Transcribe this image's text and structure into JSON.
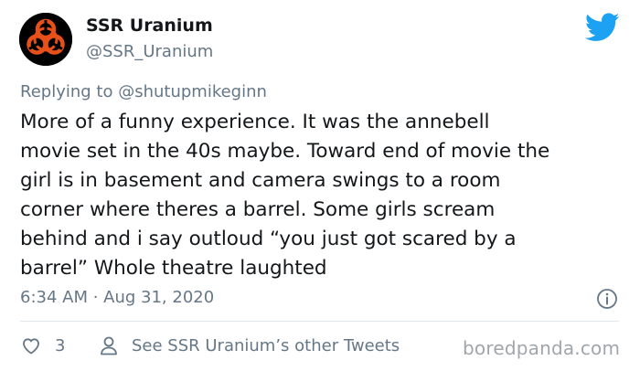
{
  "tweet": {
    "author_name": "SSR Uranium",
    "author_handle": "@SSR_Uranium",
    "reply_prefix": "Replying to ",
    "reply_handle": "@shutupmikeginn",
    "body_lines": [
      "More of a funny experience. It was the annebell",
      "movie set in the 40s maybe. Toward end of movie the",
      "girl is in basement and camera swings to a room",
      "corner where theres a barrel. Some girls scream",
      "behind and i say outloud “you just got scared by a",
      "barrel” Whole theatre laughted"
    ],
    "timestamp": "6:34 AM · Aug 31, 2020",
    "like_count": "3",
    "other_tweets_label": "See SSR Uranium’s other Tweets"
  },
  "watermark": "boredpanda.com",
  "colors": {
    "twitter_blue": "#1da1f2",
    "secondary_text": "#657786",
    "avatar_orange": "#e8501a"
  },
  "icons": {
    "avatar": "biohazard-avatar",
    "brand": "twitter-bird-icon",
    "info": "info-icon",
    "like": "heart-icon",
    "profile": "person-icon"
  }
}
